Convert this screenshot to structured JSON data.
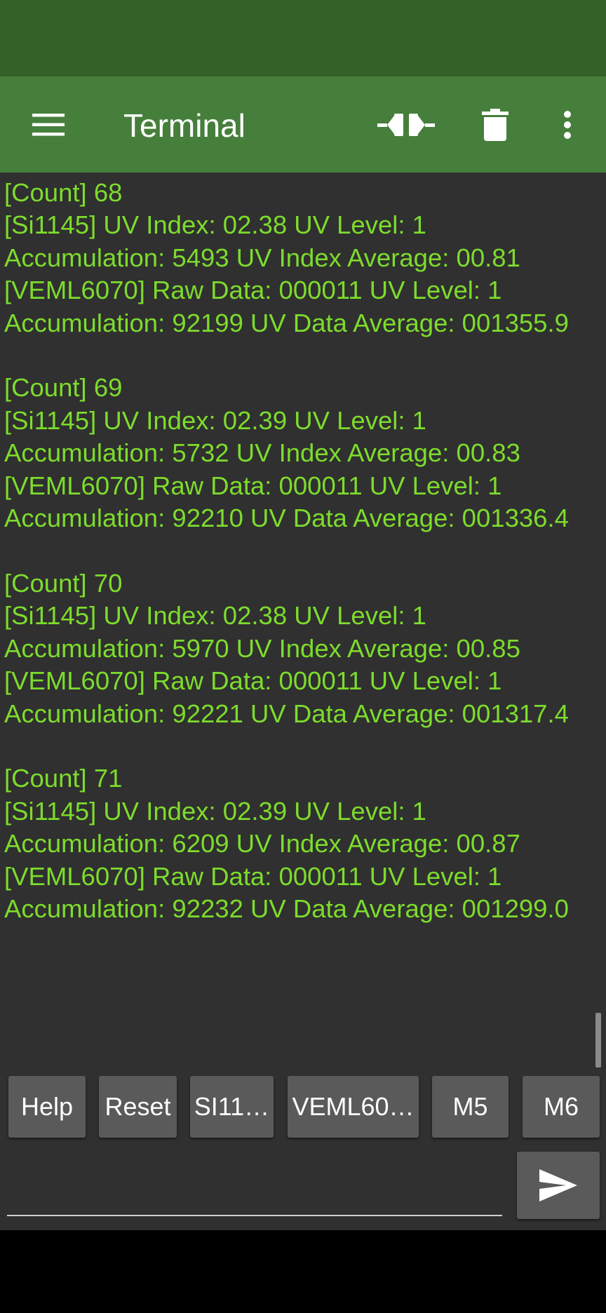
{
  "app": {
    "title": "Terminal"
  },
  "colors": {
    "status_bar": "#336127",
    "toolbar": "#467f3c",
    "terminal_bg": "#303030",
    "terminal_text": "#7ddc2c",
    "button_bg": "#5a5a5a"
  },
  "toolbar": {
    "menu_icon": "hamburger-menu-icon",
    "connect_icon": "plug-connector-icon",
    "delete_icon": "trash-icon",
    "more_icon": "more-vert-icon"
  },
  "terminal": {
    "log": "[Count] 68\n[Si1145] UV Index: 02.38 UV Level: 1\nAccumulation: 5493 UV Index Average: 00.81\n[VEML6070] Raw Data: 000011 UV Level: 1\nAccumulation: 92199 UV Data Average: 001355.9\n\n[Count] 69\n[Si1145] UV Index: 02.39 UV Level: 1\nAccumulation: 5732 UV Index Average: 00.83\n[VEML6070] Raw Data: 000011 UV Level: 1\nAccumulation: 92210 UV Data Average: 001336.4\n\n[Count] 70\n[Si1145] UV Index: 02.38 UV Level: 1\nAccumulation: 5970 UV Index Average: 00.85\n[VEML6070] Raw Data: 000011 UV Level: 1\nAccumulation: 92221 UV Data Average: 001317.4\n\n[Count] 71\n[Si1145] UV Index: 02.39 UV Level: 1\nAccumulation: 6209 UV Index Average: 00.87\n[VEML6070] Raw Data: 000011 UV Level: 1\nAccumulation: 92232 UV Data Average: 001299.0"
  },
  "macros": [
    {
      "label": "Help"
    },
    {
      "label": "Reset"
    },
    {
      "label": "SI11…"
    },
    {
      "label": "VEML60…"
    },
    {
      "label": "M5"
    },
    {
      "label": "M6"
    }
  ],
  "input": {
    "value": "",
    "send_icon": "send-icon"
  }
}
